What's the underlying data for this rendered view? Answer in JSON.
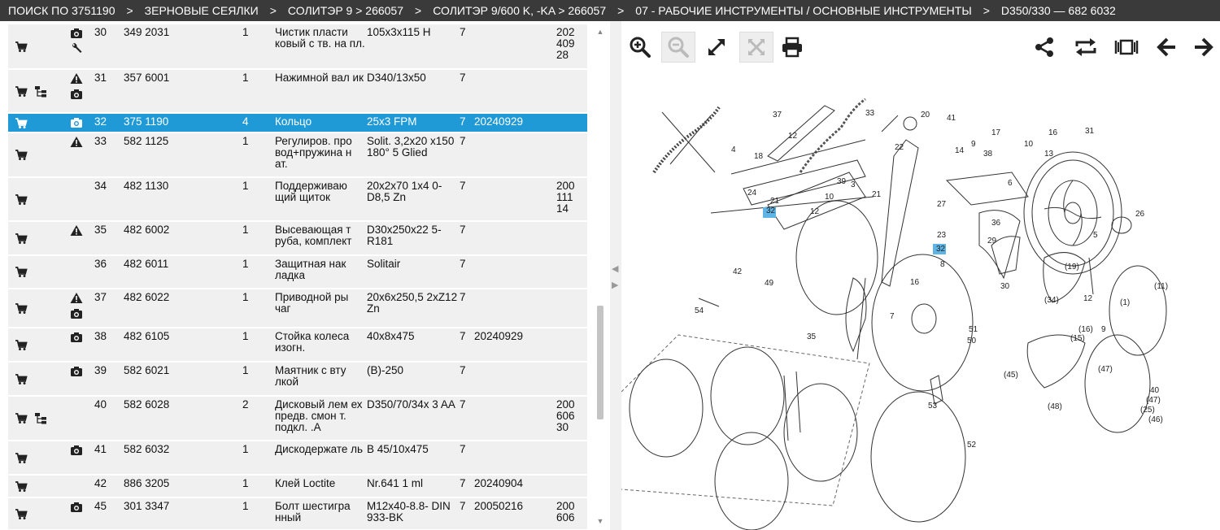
{
  "breadcrumb": [
    "ПОИСК ПО 3751190",
    "ЗЕРНОВЫЕ СЕЯЛКИ",
    "СОЛИТЭР 9 > 266057",
    "СОЛИТЭР 9/600 K, -KA > 266057",
    "07 - РАБОЧИЕ ИНСТРУМЕНТЫ / ОСНОВНЫЕ ИНСТРУМЕНТЫ",
    "D350/330 — 682 6032"
  ],
  "breadcrumb_separator": ">",
  "rows": [
    {
      "pos": "30",
      "num": "349 2031",
      "qty": "1",
      "name": "Чистик пласти ковый с тв. на пл.",
      "spec": "105x3x115 H",
      "u": "7",
      "date": "",
      "code": "202 409 28",
      "cart": true,
      "tree": false,
      "icons": [
        "camera",
        "wrench"
      ]
    },
    {
      "pos": "31",
      "num": "357 6001",
      "qty": "1",
      "name": "Нажимной вал ик",
      "spec": "D340/13x50",
      "u": "7",
      "date": "",
      "code": "",
      "cart": true,
      "tree": true,
      "icons": [
        "warning",
        "camera"
      ]
    },
    {
      "pos": "32",
      "num": "375 1190",
      "qty": "4",
      "name": "Кольцо",
      "spec": "25x3 FPM",
      "u": "7",
      "date": "20240929",
      "code": "",
      "cart": true,
      "tree": false,
      "icons": [
        "camera"
      ],
      "selected": true
    },
    {
      "pos": "33",
      "num": "582 1125",
      "qty": "1",
      "name": "Регулиров. про вод+пружина н ат.",
      "spec": "Solit. 3,2x20 x150 180° 5 Glied",
      "u": "7",
      "date": "",
      "code": "",
      "cart": true,
      "tree": false,
      "icons": [
        "warning"
      ]
    },
    {
      "pos": "34",
      "num": "482 1130",
      "qty": "1",
      "name": "Поддерживаю щий щиток",
      "spec": "20x2x70 1x4 0-D8,5 Zn",
      "u": "7",
      "date": "",
      "code": "200 111 14",
      "cart": true,
      "tree": false,
      "icons": []
    },
    {
      "pos": "35",
      "num": "482 6002",
      "qty": "1",
      "name": "Высевающая т руба, комплект",
      "spec": "D30x250x22 5-R181",
      "u": "7",
      "date": "",
      "code": "",
      "cart": true,
      "tree": false,
      "icons": [
        "warning"
      ]
    },
    {
      "pos": "36",
      "num": "482 6011",
      "qty": "1",
      "name": "Защитная нак ладка",
      "spec": "Solitair",
      "u": "7",
      "date": "",
      "code": "",
      "cart": true,
      "tree": false,
      "icons": []
    },
    {
      "pos": "37",
      "num": "482 6022",
      "qty": "1",
      "name": "Приводной ры чаг",
      "spec": "20x6x250,5 2xZ12 Zn",
      "u": "7",
      "date": "",
      "code": "",
      "cart": true,
      "tree": false,
      "icons": [
        "warning",
        "camera"
      ]
    },
    {
      "pos": "38",
      "num": "482 6105",
      "qty": "1",
      "name": "Стойка колеса изогн.",
      "spec": "40x8x475",
      "u": "7",
      "date": "20240929",
      "code": "",
      "cart": true,
      "tree": false,
      "icons": [
        "camera"
      ]
    },
    {
      "pos": "39",
      "num": "582 6021",
      "qty": "1",
      "name": "Маятник с вту лкой",
      "spec": "(B)-250",
      "u": "7",
      "date": "",
      "code": "",
      "cart": true,
      "tree": false,
      "icons": [
        "camera"
      ]
    },
    {
      "pos": "40",
      "num": "582 6028",
      "qty": "2",
      "name": "Дисковый лем ех предв. смон т. подкл. .A",
      "spec": "D350/70/34x 3 AA",
      "u": "7",
      "date": "",
      "code": "200 606 30",
      "cart": true,
      "tree": true,
      "icons": []
    },
    {
      "pos": "41",
      "num": "582 6032",
      "qty": "1",
      "name": "Дискодержате ль",
      "spec": "B 45/10x475",
      "u": "7",
      "date": "",
      "code": "",
      "cart": true,
      "tree": false,
      "icons": [
        "camera"
      ]
    },
    {
      "pos": "42",
      "num": "886 3205",
      "qty": "1",
      "name": "Клей Loctite",
      "spec": "Nr.641 1 ml",
      "u": "7",
      "date": "20240904",
      "code": "",
      "cart": true,
      "tree": false,
      "icons": []
    },
    {
      "pos": "45",
      "num": "301 3347",
      "qty": "1",
      "name": "Болт шестигра нный",
      "spec": "M12x40-8.8- DIN 933-BK",
      "u": "7",
      "date": "20050216",
      "code": "200 606",
      "cart": true,
      "tree": false,
      "icons": [
        "camera"
      ]
    }
  ],
  "toolbar": {
    "left": [
      "zoom-in-icon",
      "zoom-out-icon",
      "expand-icon",
      "fit-icon",
      "print-icon"
    ],
    "right": [
      "share-icon",
      "swap-icon",
      "split-view-icon",
      "arrow-left-icon",
      "arrow-right-icon"
    ]
  },
  "diagram_labels": [
    "37",
    "12",
    "33",
    "20",
    "41",
    "18",
    "4",
    "22",
    "14",
    "9",
    "38",
    "17",
    "10",
    "16",
    "13",
    "31",
    "24",
    "39",
    "3",
    "6",
    "21",
    "10",
    "21",
    "27",
    "12",
    "36",
    "26",
    "32",
    "23",
    "32",
    "8",
    "5",
    "29",
    "42",
    "49",
    "16",
    "(19)",
    "30",
    "(34)",
    "7",
    "12",
    "(1)",
    "(11)",
    "54",
    "35",
    "51",
    "50",
    "(16)",
    "(15)",
    "9",
    "(45)",
    "(47)",
    "40",
    "(48)",
    "(47)",
    "(25)",
    "(46)",
    "53",
    "52"
  ],
  "colors": {
    "selected_row": "#1f9ad6",
    "breadcrumb_bg": "#3a3a3a",
    "row_bg": "#f0f0f0",
    "highlight": "#5fb4e6"
  }
}
